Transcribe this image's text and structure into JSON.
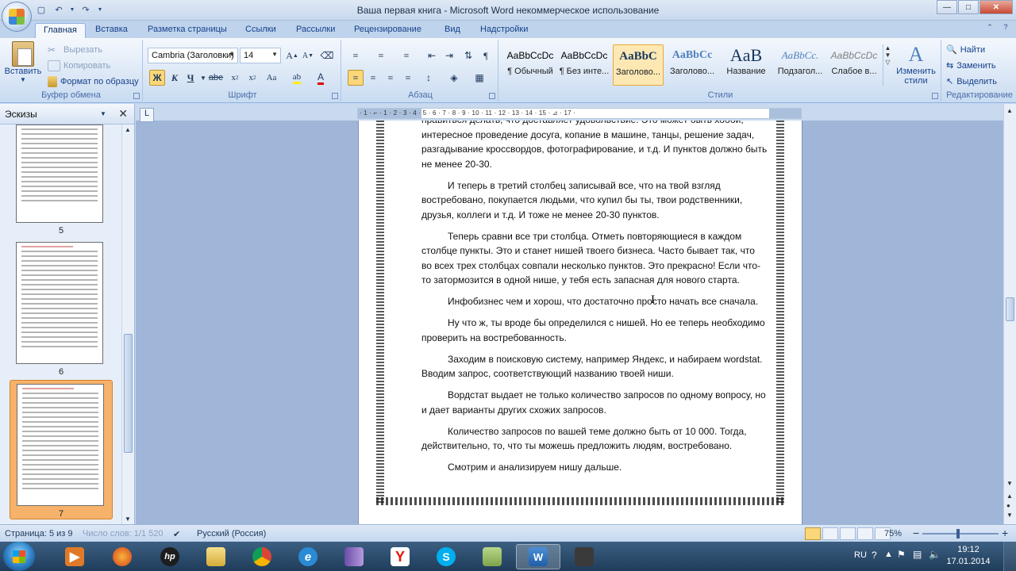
{
  "window": {
    "title": "Ваша первая книга - Microsoft Word некоммерческое использование"
  },
  "qat": {
    "save_icon": "save-icon",
    "undo_icon": "undo-icon",
    "redo_icon": "redo-icon"
  },
  "tabs": [
    {
      "label": "Главная",
      "active": true
    },
    {
      "label": "Вставка"
    },
    {
      "label": "Разметка страницы"
    },
    {
      "label": "Ссылки"
    },
    {
      "label": "Рассылки"
    },
    {
      "label": "Рецензирование"
    },
    {
      "label": "Вид"
    },
    {
      "label": "Надстройки"
    }
  ],
  "clipboard": {
    "paste": "Вставить",
    "cut": "Вырезать",
    "copy": "Копировать",
    "format_painter": "Формат по образцу",
    "label": "Буфер обмена"
  },
  "font": {
    "name": "Cambria (Заголовки)",
    "size": "14",
    "label": "Шрифт"
  },
  "paragraph": {
    "label": "Абзац"
  },
  "styles": {
    "label": "Стили",
    "items": [
      {
        "sample": "AaBbCcDc",
        "name": "¶ Обычный"
      },
      {
        "sample": "AaBbCcDc",
        "name": "¶ Без инте..."
      },
      {
        "sample": "AaBbC",
        "name": "Заголово...",
        "selected": true
      },
      {
        "sample": "AaBbCc",
        "name": "Заголово..."
      },
      {
        "sample": "AaB",
        "name": "Название"
      },
      {
        "sample": "AaBbCc.",
        "name": "Подзагол..."
      },
      {
        "sample": "AaBbCcDc",
        "name": "Слабое в..."
      }
    ],
    "change_styles": "Изменить стили"
  },
  "editing": {
    "find": "Найти",
    "replace": "Заменить",
    "select": "Выделить",
    "label": "Редактирование"
  },
  "pane": {
    "title": "Эскизы",
    "pages": [
      "5",
      "6",
      "7"
    ]
  },
  "ruler": {
    "text": "· 1 · ⌐ · 1 · 2 · 3 · 4 · 5 · 6 · 7 · 8 · 9 · 10 · 11 · 12 · 13 · 14 · 15 · ⊿ · 17 ·"
  },
  "document": {
    "paragraphs": [
      "нравиться делать, что доставляет удовольствие. Это может быть хобби, интересное проведение досуга, копание в машине, танцы, решение задач, разгадывание кроссвордов, фотографирование, и т.д. И пунктов должно быть не менее 20-30.",
      "И теперь в третий столбец записывай все, что на твой взгляд востребовано, покупается людьми, что купил бы ты, твои родственники, друзья, коллеги и т.д. И тоже не менее 20-30 пунктов.",
      "Теперь сравни все три столбца. Отметь повторяющиеся в каждом столбце пункты. Это и станет нишей твоего бизнеса. Часто бывает так, что во всех трех столбцах совпали несколько пунктов. Это прекрасно! Если что-то затормозится в одной нише, у тебя есть запасная для нового старта.",
      "Инфобизнес чем и хорош, что достаточно просто начать все сначала.",
      "Ну что ж, ты вроде бы определился с нишей. Но ее теперь необходимо проверить на востребованность.",
      "Заходим в поисковую систему, например Яндекс, и набираем wordstat. Вводим запрос, соответствующий названию твоей ниши.",
      "Вордстат выдает не только количество запросов по одному вопросу, но и дает варианты других схожих запросов.",
      "Количество запросов по вашей теме должно быть от 10 000. Тогда, действительно, то, что ты можешь предложить людям, востребовано.",
      "Смотрим и анализируем нишу дальше."
    ]
  },
  "status": {
    "page": "Страница: 5 из 9",
    "words": "Число слов: 1/1 520",
    "language": "Русский (Россия)",
    "zoom": "75%"
  },
  "taskbar": {
    "apps": [
      "folder-icon",
      "media-player-icon",
      "firefox-icon",
      "hp-icon",
      "explorer-folder-icon",
      "chrome-icon",
      "ie-icon",
      "archive-icon",
      "yandex-icon",
      "skype-icon",
      "notes-icon",
      "word-icon",
      "camera-icon"
    ],
    "lang": "RU",
    "time": "19:12",
    "date": "17.01.2014"
  }
}
